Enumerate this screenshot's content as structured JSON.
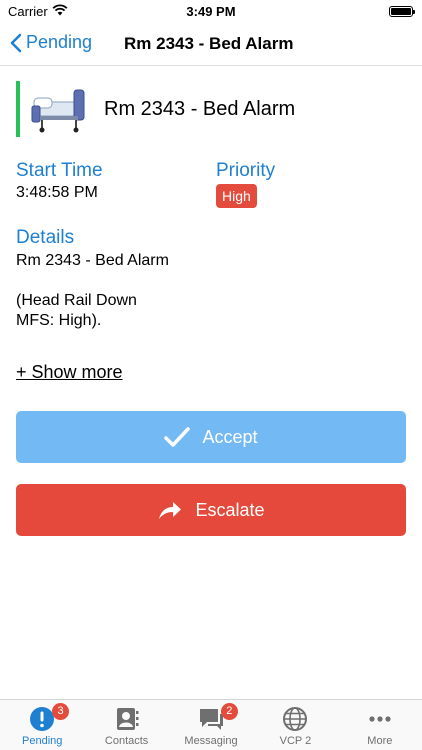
{
  "status_bar": {
    "carrier": "Carrier",
    "time": "3:49 PM"
  },
  "nav": {
    "back_label": "Pending",
    "title": "Rm 2343 - Bed Alarm"
  },
  "alarm": {
    "title": "Rm 2343 - Bed Alarm",
    "start_time_label": "Start Time",
    "start_time_value": "3:48:58 PM",
    "priority_label": "Priority",
    "priority_value": "High",
    "details_label": "Details",
    "details_text": "Rm 2343 - Bed Alarm\n\n(Head Rail Down\nMFS: High).",
    "show_more": "+ Show more"
  },
  "actions": {
    "accept_label": "Accept",
    "escalate_label": "Escalate"
  },
  "tabs": [
    {
      "label": "Pending",
      "icon": "alert-circle-icon",
      "badge": "3",
      "active": true
    },
    {
      "label": "Contacts",
      "icon": "contacts-icon",
      "badge": "",
      "active": false
    },
    {
      "label": "Messaging",
      "icon": "chat-icon",
      "badge": "2",
      "active": false
    },
    {
      "label": "VCP 2",
      "icon": "globe-icon",
      "badge": "",
      "active": false
    },
    {
      "label": "More",
      "icon": "more-icon",
      "badge": "",
      "active": false
    }
  ],
  "colors": {
    "accent": "#1f7fd0",
    "status_green": "#27c15a",
    "priority_red": "#e34b3c",
    "accept_blue": "#73baf5",
    "escalate_red": "#e5493b"
  }
}
